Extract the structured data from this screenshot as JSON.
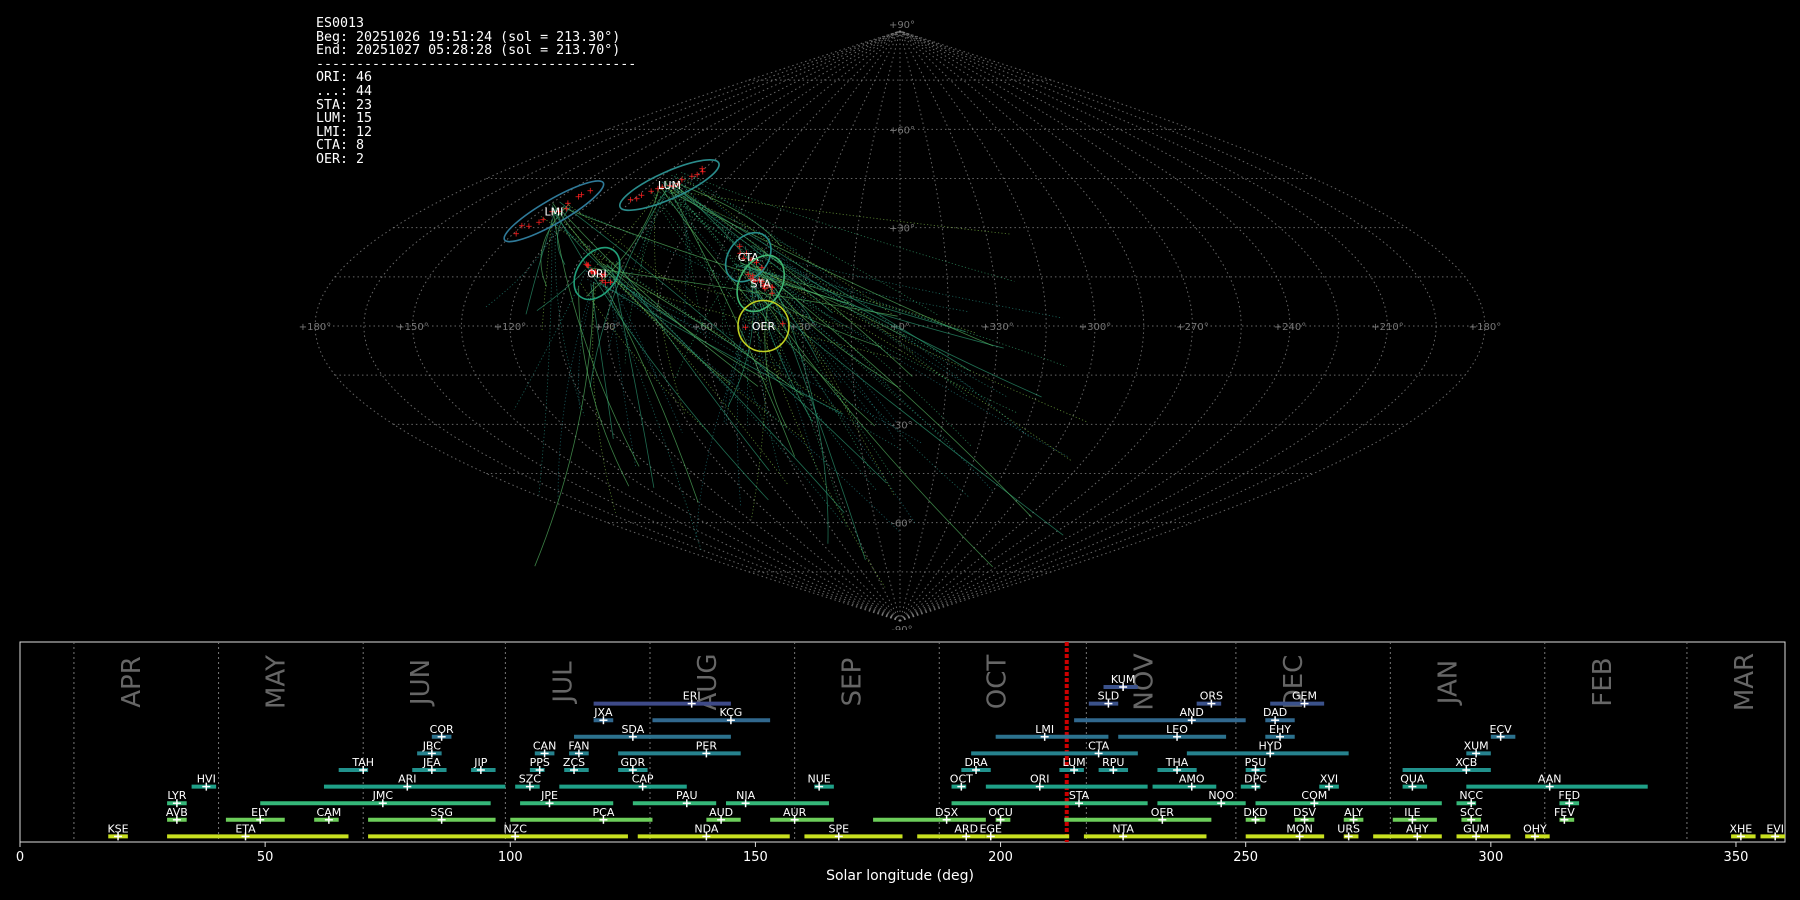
{
  "stats_panel": {
    "lines": [
      "ES0013",
      "Beg: 20251026 19:51:24 (sol = 213.30°)",
      "End: 20251027 05:28:28 (sol = 213.70°)",
      "----------------------------------------",
      "ORI: 46",
      "...: 44",
      "STA: 23",
      "LUM: 15",
      "LMI: 12",
      "CTA: 8",
      "OER: 2"
    ]
  },
  "colors": {
    "background": "#000000",
    "grid": "#8a8a8a",
    "radiant_marker": "#ff2020",
    "current_sol_line": "#cc0000",
    "viridis_dark": "#3b528b",
    "viridis_blue": "#31688e",
    "viridis_teal": "#21918c",
    "viridis_green": "#35b779",
    "viridis_lime": "#90d743",
    "viridis_yellow": "#c8e020"
  },
  "chart_data": [
    {
      "type": "scatter",
      "projection": "sinusoidal",
      "description_labels": {
        "lon_ticks": [
          "+180°",
          "+150°",
          "+120°",
          "+90°",
          "+60°",
          "+30°",
          "+0°",
          "+330°",
          "+300°",
          "+270°",
          "+240°",
          "+210°",
          "+180°"
        ],
        "lat_ticks": [
          "+90°",
          "+60°",
          "+30°",
          "-30°",
          "-60°",
          "-90°"
        ]
      },
      "lon_tick_values": [
        180,
        150,
        120,
        90,
        60,
        30,
        0,
        330,
        300,
        270,
        240,
        210,
        180
      ],
      "lat_tick_values": [
        90,
        60,
        30,
        -30,
        -60,
        -90
      ],
      "showers": [
        {
          "code": "LUM",
          "lon": 97,
          "lat": 43,
          "rx": 36,
          "ry": 9,
          "angle": -24,
          "ring_color": "#2a8c8c",
          "count": 15
        },
        {
          "code": "LMI",
          "lon": 130,
          "lat": 35,
          "rx": 38,
          "ry": 8,
          "angle": -30,
          "ring_color": "#2f7a99",
          "count": 12
        },
        {
          "code": "ORI",
          "lon": 97,
          "lat": 16,
          "rx": 13,
          "ry": 19,
          "angle": 35,
          "ring_color": "#21a07a",
          "count": 46
        },
        {
          "code": "CTA",
          "lon": 50,
          "lat": 21,
          "rx": 13,
          "ry": 18,
          "angle": 38,
          "ring_color": "#27908c",
          "count": 8
        },
        {
          "code": "STA",
          "lon": 44,
          "lat": 13,
          "rx": 14,
          "ry": 20,
          "angle": 30,
          "ring_color": "#3fb872",
          "count": 23
        },
        {
          "code": "OER",
          "lon": 42,
          "lat": 0,
          "rx": 17,
          "ry": 17,
          "angle": 0,
          "ring_color": "#c0d020",
          "count": 2
        }
      ]
    },
    {
      "type": "bar",
      "subtype": "timeline",
      "xlabel": "Solar longitude (deg)",
      "xlim": [
        0,
        360
      ],
      "x_ticks": [
        0,
        50,
        100,
        150,
        200,
        250,
        300,
        350
      ],
      "current_sol": 213.5,
      "months": [
        {
          "name": "APR",
          "start": 11
        },
        {
          "name": "MAY",
          "start": 40.5
        },
        {
          "name": "JUN",
          "start": 70
        },
        {
          "name": "JUL",
          "start": 99
        },
        {
          "name": "AUG",
          "start": 128.5
        },
        {
          "name": "SEP",
          "start": 158
        },
        {
          "name": "OCT",
          "start": 187.5
        },
        {
          "name": "NOV",
          "start": 217.5
        },
        {
          "name": "DEC",
          "start": 248
        },
        {
          "name": "JAN",
          "start": 279.5
        },
        {
          "name": "FEB",
          "start": 311
        },
        {
          "name": "MAR",
          "start": 340
        }
      ],
      "showers": [
        {
          "code": "KUM",
          "row": 0,
          "start": 221,
          "end": 228,
          "peak": 225,
          "color": "#3b528b"
        },
        {
          "code": "ERI",
          "row": 1,
          "start": 117,
          "end": 145,
          "peak": 137,
          "color": "#3e4a89"
        },
        {
          "code": "SLD",
          "row": 1,
          "start": 218,
          "end": 224,
          "peak": 222,
          "color": "#3b528b"
        },
        {
          "code": "ORS",
          "row": 1,
          "start": 240,
          "end": 245,
          "peak": 243,
          "color": "#3b528b"
        },
        {
          "code": "GEM",
          "row": 1,
          "start": 255,
          "end": 266,
          "peak": 262,
          "color": "#3b528b"
        },
        {
          "code": "JXA",
          "row": 2,
          "start": 117,
          "end": 121,
          "peak": 119,
          "color": "#31688e"
        },
        {
          "code": "KCG",
          "row": 2,
          "start": 129,
          "end": 153,
          "peak": 145,
          "color": "#31688e"
        },
        {
          "code": "AND",
          "row": 2,
          "start": 215,
          "end": 250,
          "peak": 239,
          "color": "#31688e"
        },
        {
          "code": "DAD",
          "row": 2,
          "start": 254,
          "end": 260,
          "peak": 256,
          "color": "#31688e"
        },
        {
          "code": "COR",
          "row": 3,
          "start": 84,
          "end": 88,
          "peak": 86,
          "color": "#2c728e"
        },
        {
          "code": "SDA",
          "row": 3,
          "start": 113,
          "end": 145,
          "peak": 125,
          "color": "#2c728e"
        },
        {
          "code": "LMI",
          "row": 3,
          "start": 199,
          "end": 222,
          "peak": 209,
          "color": "#2c728e"
        },
        {
          "code": "LEO",
          "row": 3,
          "start": 224,
          "end": 246,
          "peak": 236,
          "color": "#2c728e"
        },
        {
          "code": "EHY",
          "row": 3,
          "start": 254,
          "end": 260,
          "peak": 257,
          "color": "#2c728e"
        },
        {
          "code": "ECV",
          "row": 3,
          "start": 300,
          "end": 305,
          "peak": 302,
          "color": "#2c728e"
        },
        {
          "code": "JBC",
          "row": 4,
          "start": 81,
          "end": 86,
          "peak": 84,
          "color": "#26828e"
        },
        {
          "code": "CAN",
          "row": 4,
          "start": 105,
          "end": 109,
          "peak": 107,
          "color": "#26828e"
        },
        {
          "code": "FAN",
          "row": 4,
          "start": 112,
          "end": 116,
          "peak": 114,
          "color": "#26828e"
        },
        {
          "code": "PER",
          "row": 4,
          "start": 122,
          "end": 147,
          "peak": 140,
          "color": "#26828e"
        },
        {
          "code": "CTA",
          "row": 4,
          "start": 194,
          "end": 228,
          "peak": 220,
          "color": "#26828e"
        },
        {
          "code": "HYD",
          "row": 4,
          "start": 238,
          "end": 271,
          "peak": 255,
          "color": "#26828e"
        },
        {
          "code": "XUM",
          "row": 4,
          "start": 295,
          "end": 300,
          "peak": 297,
          "color": "#26828e"
        },
        {
          "code": "TAH",
          "row": 5,
          "start": 65,
          "end": 71,
          "peak": 70,
          "color": "#21918c"
        },
        {
          "code": "JEA",
          "row": 5,
          "start": 80,
          "end": 87,
          "peak": 84,
          "color": "#21918c"
        },
        {
          "code": "JIP",
          "row": 5,
          "start": 92,
          "end": 97,
          "peak": 94,
          "color": "#21918c"
        },
        {
          "code": "PPS",
          "row": 5,
          "start": 104,
          "end": 107,
          "peak": 106,
          "color": "#21918c"
        },
        {
          "code": "ZCS",
          "row": 5,
          "start": 111,
          "end": 116,
          "peak": 113,
          "color": "#21918c"
        },
        {
          "code": "GDR",
          "row": 5,
          "start": 122,
          "end": 128,
          "peak": 125,
          "color": "#21918c"
        },
        {
          "code": "DRA",
          "row": 5,
          "start": 192,
          "end": 198,
          "peak": 195,
          "color": "#21918c"
        },
        {
          "code": "LUM",
          "row": 5,
          "start": 212,
          "end": 217,
          "peak": 215,
          "color": "#21918c"
        },
        {
          "code": "RPU",
          "row": 5,
          "start": 220,
          "end": 226,
          "peak": 223,
          "color": "#21918c"
        },
        {
          "code": "THA",
          "row": 5,
          "start": 232,
          "end": 240,
          "peak": 236,
          "color": "#21918c"
        },
        {
          "code": "PSU",
          "row": 5,
          "start": 250,
          "end": 254,
          "peak": 252,
          "color": "#21918c"
        },
        {
          "code": "XCB",
          "row": 5,
          "start": 282,
          "end": 300,
          "peak": 295,
          "color": "#21918c"
        },
        {
          "code": "HVI",
          "row": 6,
          "start": 35,
          "end": 40,
          "peak": 38,
          "color": "#1fa088"
        },
        {
          "code": "ARI",
          "row": 6,
          "start": 62,
          "end": 99,
          "peak": 79,
          "color": "#1fa088"
        },
        {
          "code": "SZC",
          "row": 6,
          "start": 101,
          "end": 106,
          "peak": 104,
          "color": "#1fa088"
        },
        {
          "code": "CAP",
          "row": 6,
          "start": 110,
          "end": 136,
          "peak": 127,
          "color": "#1fa088"
        },
        {
          "code": "NUE",
          "row": 6,
          "start": 162,
          "end": 166,
          "peak": 163,
          "color": "#1fa088"
        },
        {
          "code": "OCT",
          "row": 6,
          "start": 190,
          "end": 193,
          "peak": 192,
          "color": "#1fa088"
        },
        {
          "code": "ORI",
          "row": 6,
          "start": 197,
          "end": 230,
          "peak": 208,
          "color": "#1fa088"
        },
        {
          "code": "AMO",
          "row": 6,
          "start": 231,
          "end": 244,
          "peak": 239,
          "color": "#1fa088"
        },
        {
          "code": "DPC",
          "row": 6,
          "start": 249,
          "end": 253,
          "peak": 252,
          "color": "#1fa088"
        },
        {
          "code": "XVI",
          "row": 6,
          "start": 265,
          "end": 269,
          "peak": 267,
          "color": "#1fa088"
        },
        {
          "code": "QUA",
          "row": 6,
          "start": 282,
          "end": 287,
          "peak": 284,
          "color": "#1fa088"
        },
        {
          "code": "AAN",
          "row": 6,
          "start": 295,
          "end": 332,
          "peak": 312,
          "color": "#1fa088"
        },
        {
          "code": "LYR",
          "row": 7,
          "start": 30,
          "end": 34,
          "peak": 32,
          "color": "#35b779"
        },
        {
          "code": "JMC",
          "row": 7,
          "start": 49,
          "end": 96,
          "peak": 74,
          "color": "#35b779"
        },
        {
          "code": "JPE",
          "row": 7,
          "start": 102,
          "end": 121,
          "peak": 108,
          "color": "#35b779"
        },
        {
          "code": "PAU",
          "row": 7,
          "start": 125,
          "end": 142,
          "peak": 136,
          "color": "#35b779"
        },
        {
          "code": "NIA",
          "row": 7,
          "start": 144,
          "end": 165,
          "peak": 148,
          "color": "#35b779"
        },
        {
          "code": "STA",
          "row": 7,
          "start": 190,
          "end": 230,
          "peak": 216,
          "color": "#35b779"
        },
        {
          "code": "NOO",
          "row": 7,
          "start": 232,
          "end": 250,
          "peak": 245,
          "color": "#35b779"
        },
        {
          "code": "COM",
          "row": 7,
          "start": 252,
          "end": 290,
          "peak": 264,
          "color": "#35b779"
        },
        {
          "code": "NCC",
          "row": 7,
          "start": 293,
          "end": 297,
          "peak": 296,
          "color": "#35b779"
        },
        {
          "code": "FED",
          "row": 7,
          "start": 314,
          "end": 318,
          "peak": 316,
          "color": "#35b779"
        },
        {
          "code": "AVB",
          "row": 8,
          "start": 30,
          "end": 34,
          "peak": 32,
          "color": "#6ccd5a"
        },
        {
          "code": "ELY",
          "row": 8,
          "start": 42,
          "end": 54,
          "peak": 49,
          "color": "#6ccd5a"
        },
        {
          "code": "CAM",
          "row": 8,
          "start": 60,
          "end": 65,
          "peak": 63,
          "color": "#6ccd5a"
        },
        {
          "code": "SSG",
          "row": 8,
          "start": 71,
          "end": 97,
          "peak": 86,
          "color": "#6ccd5a"
        },
        {
          "code": "PCA",
          "row": 8,
          "start": 100,
          "end": 129,
          "peak": 119,
          "color": "#6ccd5a"
        },
        {
          "code": "AUD",
          "row": 8,
          "start": 140,
          "end": 147,
          "peak": 143,
          "color": "#6ccd5a"
        },
        {
          "code": "AUR",
          "row": 8,
          "start": 153,
          "end": 166,
          "peak": 158,
          "color": "#6ccd5a"
        },
        {
          "code": "DSX",
          "row": 8,
          "start": 174,
          "end": 197,
          "peak": 189,
          "color": "#6ccd5a"
        },
        {
          "code": "OCU",
          "row": 8,
          "start": 199,
          "end": 202,
          "peak": 200,
          "color": "#6ccd5a"
        },
        {
          "code": "OER",
          "row": 8,
          "start": 213,
          "end": 243,
          "peak": 233,
          "color": "#6ccd5a"
        },
        {
          "code": "DKD",
          "row": 8,
          "start": 250,
          "end": 254,
          "peak": 252,
          "color": "#6ccd5a"
        },
        {
          "code": "DSV",
          "row": 8,
          "start": 260,
          "end": 264,
          "peak": 262,
          "color": "#6ccd5a"
        },
        {
          "code": "ALY",
          "row": 8,
          "start": 270,
          "end": 274,
          "peak": 272,
          "color": "#6ccd5a"
        },
        {
          "code": "ILE",
          "row": 8,
          "start": 280,
          "end": 289,
          "peak": 284,
          "color": "#6ccd5a"
        },
        {
          "code": "SCC",
          "row": 8,
          "start": 294,
          "end": 298,
          "peak": 296,
          "color": "#6ccd5a"
        },
        {
          "code": "FEV",
          "row": 8,
          "start": 314,
          "end": 317,
          "peak": 315,
          "color": "#6ccd5a"
        },
        {
          "code": "KSE",
          "row": 9,
          "start": 18,
          "end": 22,
          "peak": 20,
          "color": "#c8e020"
        },
        {
          "code": "ETA",
          "row": 9,
          "start": 30,
          "end": 67,
          "peak": 46,
          "color": "#c8e020"
        },
        {
          "code": "NZC",
          "row": 9,
          "start": 71,
          "end": 124,
          "peak": 101,
          "color": "#c8e020"
        },
        {
          "code": "NDA",
          "row": 9,
          "start": 126,
          "end": 157,
          "peak": 140,
          "color": "#c8e020"
        },
        {
          "code": "SPE",
          "row": 9,
          "start": 160,
          "end": 180,
          "peak": 167,
          "color": "#c8e020"
        },
        {
          "code": "ARD",
          "row": 9,
          "start": 183,
          "end": 197,
          "peak": 193,
          "color": "#c8e020"
        },
        {
          "code": "EGE",
          "row": 9,
          "start": 197,
          "end": 214,
          "peak": 198,
          "color": "#c8e020"
        },
        {
          "code": "NTA",
          "row": 9,
          "start": 217,
          "end": 242,
          "peak": 225,
          "color": "#c8e020"
        },
        {
          "code": "MON",
          "row": 9,
          "start": 250,
          "end": 266,
          "peak": 261,
          "color": "#c8e020"
        },
        {
          "code": "URS",
          "row": 9,
          "start": 270,
          "end": 273,
          "peak": 271,
          "color": "#c8e020"
        },
        {
          "code": "AHY",
          "row": 9,
          "start": 276,
          "end": 290,
          "peak": 285,
          "color": "#c8e020"
        },
        {
          "code": "GUM",
          "row": 9,
          "start": 293,
          "end": 304,
          "peak": 297,
          "color": "#c8e020"
        },
        {
          "code": "OHY",
          "row": 9,
          "start": 307,
          "end": 312,
          "peak": 309,
          "color": "#c8e020"
        },
        {
          "code": "XHE",
          "row": 9,
          "start": 349,
          "end": 354,
          "peak": 351,
          "color": "#c8e020"
        },
        {
          "code": "EVI",
          "row": 9,
          "start": 355,
          "end": 360,
          "peak": 358,
          "color": "#c8e020"
        }
      ]
    }
  ]
}
